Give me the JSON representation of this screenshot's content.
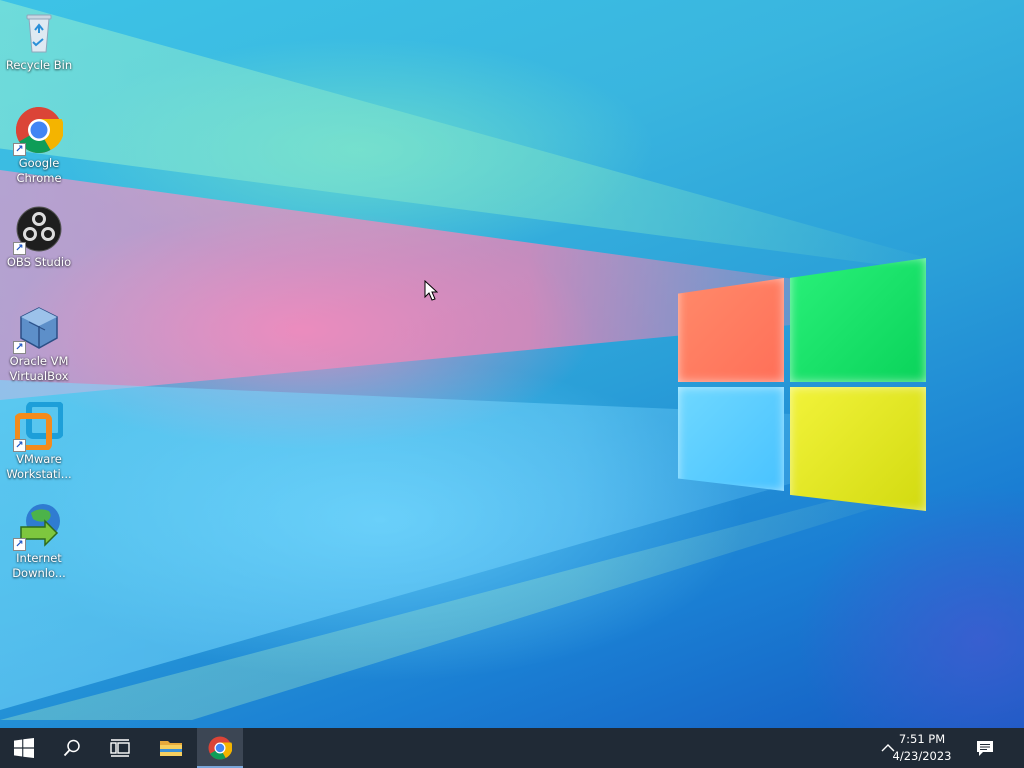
{
  "desktop": {
    "icons": [
      {
        "label": "Recycle Bin",
        "icon": "recycle-bin-icon"
      },
      {
        "label": "Google Chrome",
        "icon": "chrome-icon"
      },
      {
        "label": "OBS Studio",
        "icon": "obs-icon"
      },
      {
        "label": "Oracle VM VirtualBox",
        "icon": "virtualbox-icon"
      },
      {
        "label": "VMware Workstati...",
        "icon": "vmware-icon"
      },
      {
        "label": "Internet Downlo...",
        "icon": "idm-icon"
      }
    ]
  },
  "taskbar": {
    "items": [
      {
        "name": "start",
        "icon": "windows-start-icon"
      },
      {
        "name": "search",
        "icon": "search-icon"
      },
      {
        "name": "task-view",
        "icon": "task-view-icon"
      },
      {
        "name": "file-explorer",
        "icon": "folder-icon"
      },
      {
        "name": "google-chrome",
        "icon": "chrome-icon",
        "active": true
      }
    ],
    "tray": {
      "show_hidden_icon": "chevron-up-icon",
      "time": "7:51 PM",
      "date": "4/23/2023",
      "notification_icon": "action-center-icon"
    }
  },
  "colors": {
    "taskbar": "#202a36",
    "logo_red": "#ff7a60",
    "logo_green": "#14e068",
    "logo_blue": "#56c8ff",
    "logo_yellow": "#e6ea22"
  }
}
